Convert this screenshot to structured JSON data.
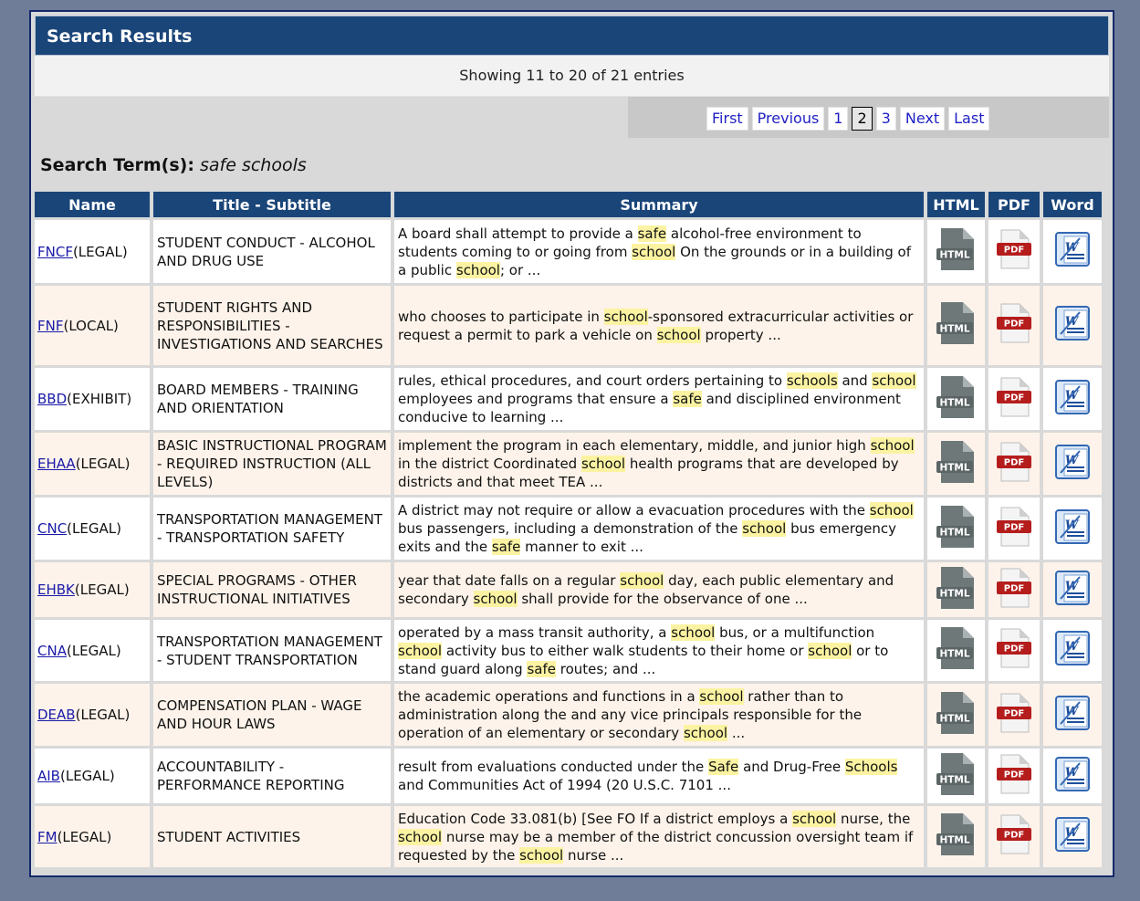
{
  "header": {
    "title": "Search Results"
  },
  "showing": "Showing 11 to 20 of 21 entries",
  "pager": {
    "first": "First",
    "previous": "Previous",
    "pages": [
      "1",
      "2",
      "3"
    ],
    "current": "2",
    "next": "Next",
    "last": "Last"
  },
  "search": {
    "label": "Search Term(s):",
    "term": "safe schools"
  },
  "columns": [
    "Name",
    "Title - Subtitle",
    "Summary",
    "HTML",
    "PDF",
    "Word"
  ],
  "icons": {
    "html_label": "HTML",
    "pdf_label": "PDF",
    "word_label": "W"
  },
  "rows": [
    {
      "code": "FNCF",
      "type": "(LEGAL)",
      "title": "STUDENT CONDUCT - ALCOHOL AND DRUG USE",
      "summary": [
        {
          "t": "A board shall attempt to provide a "
        },
        {
          "t": "safe",
          "h": true
        },
        {
          "t": " alcohol-free environment to students coming to or going from "
        },
        {
          "t": "school",
          "h": true
        },
        {
          "t": " On the grounds or in a building of a public "
        },
        {
          "t": "school",
          "h": true
        },
        {
          "t": "; or ..."
        }
      ]
    },
    {
      "code": "FNF",
      "type": "(LOCAL)",
      "title": "STUDENT RIGHTS AND RESPONSIBILITIES - INVESTIGATIONS AND SEARCHES",
      "summary": [
        {
          "t": "who chooses to participate in "
        },
        {
          "t": "school",
          "h": true
        },
        {
          "t": "-sponsored extracurricular activities or request a permit to park a vehicle on "
        },
        {
          "t": "school",
          "h": true
        },
        {
          "t": " property ..."
        }
      ]
    },
    {
      "code": "BBD",
      "type": "(EXHIBIT)",
      "title": "BOARD MEMBERS - TRAINING AND ORIENTATION",
      "summary": [
        {
          "t": "rules, ethical procedures, and court orders pertaining to "
        },
        {
          "t": "schools",
          "h": true
        },
        {
          "t": " and "
        },
        {
          "t": "school",
          "h": true
        },
        {
          "t": " employees and programs that ensure a "
        },
        {
          "t": "safe",
          "h": true
        },
        {
          "t": " and disciplined environment conducive to learning ..."
        }
      ]
    },
    {
      "code": "EHAA",
      "type": "(LEGAL)",
      "title": "BASIC INSTRUCTIONAL PROGRAM - REQUIRED INSTRUCTION (ALL LEVELS)",
      "summary": [
        {
          "t": "implement the program in each elementary, middle, and junior high "
        },
        {
          "t": "school",
          "h": true
        },
        {
          "t": " in the district Coordinated "
        },
        {
          "t": "school",
          "h": true
        },
        {
          "t": " health programs that are developed by districts and that meet TEA ..."
        }
      ]
    },
    {
      "code": "CNC",
      "type": "(LEGAL)",
      "title": "TRANSPORTATION MANAGEMENT - TRANSPORTATION SAFETY",
      "summary": [
        {
          "t": "A district may not require or allow a evacuation procedures with the "
        },
        {
          "t": "school",
          "h": true
        },
        {
          "t": " bus passengers, including a demonstration of the "
        },
        {
          "t": "school",
          "h": true
        },
        {
          "t": " bus emergency exits and the "
        },
        {
          "t": "safe",
          "h": true
        },
        {
          "t": " manner to exit ..."
        }
      ]
    },
    {
      "code": "EHBK",
      "type": "(LEGAL)",
      "title": "SPECIAL PROGRAMS - OTHER INSTRUCTIONAL INITIATIVES",
      "summary": [
        {
          "t": "year that date falls on a regular "
        },
        {
          "t": "school",
          "h": true
        },
        {
          "t": " day, each public elementary and secondary "
        },
        {
          "t": "school",
          "h": true
        },
        {
          "t": " shall provide for the observance of one ..."
        }
      ]
    },
    {
      "code": "CNA",
      "type": "(LEGAL)",
      "title": "TRANSPORTATION MANAGEMENT - STUDENT TRANSPORTATION",
      "summary": [
        {
          "t": "operated by a mass transit authority, a "
        },
        {
          "t": "school",
          "h": true
        },
        {
          "t": " bus, or a multifunction "
        },
        {
          "t": "school",
          "h": true
        },
        {
          "t": " activity bus to either walk students to their home or "
        },
        {
          "t": "school",
          "h": true
        },
        {
          "t": " or to stand guard along "
        },
        {
          "t": "safe",
          "h": true
        },
        {
          "t": " routes; and ..."
        }
      ]
    },
    {
      "code": "DEAB",
      "type": "(LEGAL)",
      "title": "COMPENSATION PLAN - WAGE AND HOUR LAWS",
      "summary": [
        {
          "t": "the academic operations and functions in a "
        },
        {
          "t": "school",
          "h": true
        },
        {
          "t": " rather than to administration along the and any vice principals responsible for the operation of an elementary or secondary "
        },
        {
          "t": "school",
          "h": true
        },
        {
          "t": " ..."
        }
      ]
    },
    {
      "code": "AIB",
      "type": "(LEGAL)",
      "title": "ACCOUNTABILITY - PERFORMANCE REPORTING",
      "summary": [
        {
          "t": "result from evaluations conducted under the "
        },
        {
          "t": "Safe",
          "h": true
        },
        {
          "t": " and Drug-Free "
        },
        {
          "t": "Schools",
          "h": true
        },
        {
          "t": " and Communities Act of 1994 (20 U.S.C. 7101 ..."
        }
      ]
    },
    {
      "code": "FM",
      "type": "(LEGAL)",
      "title": "STUDENT ACTIVITIES",
      "summary": [
        {
          "t": "Education Code 33.081(b) [See FO If a district employs a "
        },
        {
          "t": "school",
          "h": true
        },
        {
          "t": " nurse, the "
        },
        {
          "t": "school",
          "h": true
        },
        {
          "t": " nurse may be a member of the district concussion oversight team if requested by the "
        },
        {
          "t": "school",
          "h": true
        },
        {
          "t": " nurse ..."
        }
      ]
    }
  ]
}
